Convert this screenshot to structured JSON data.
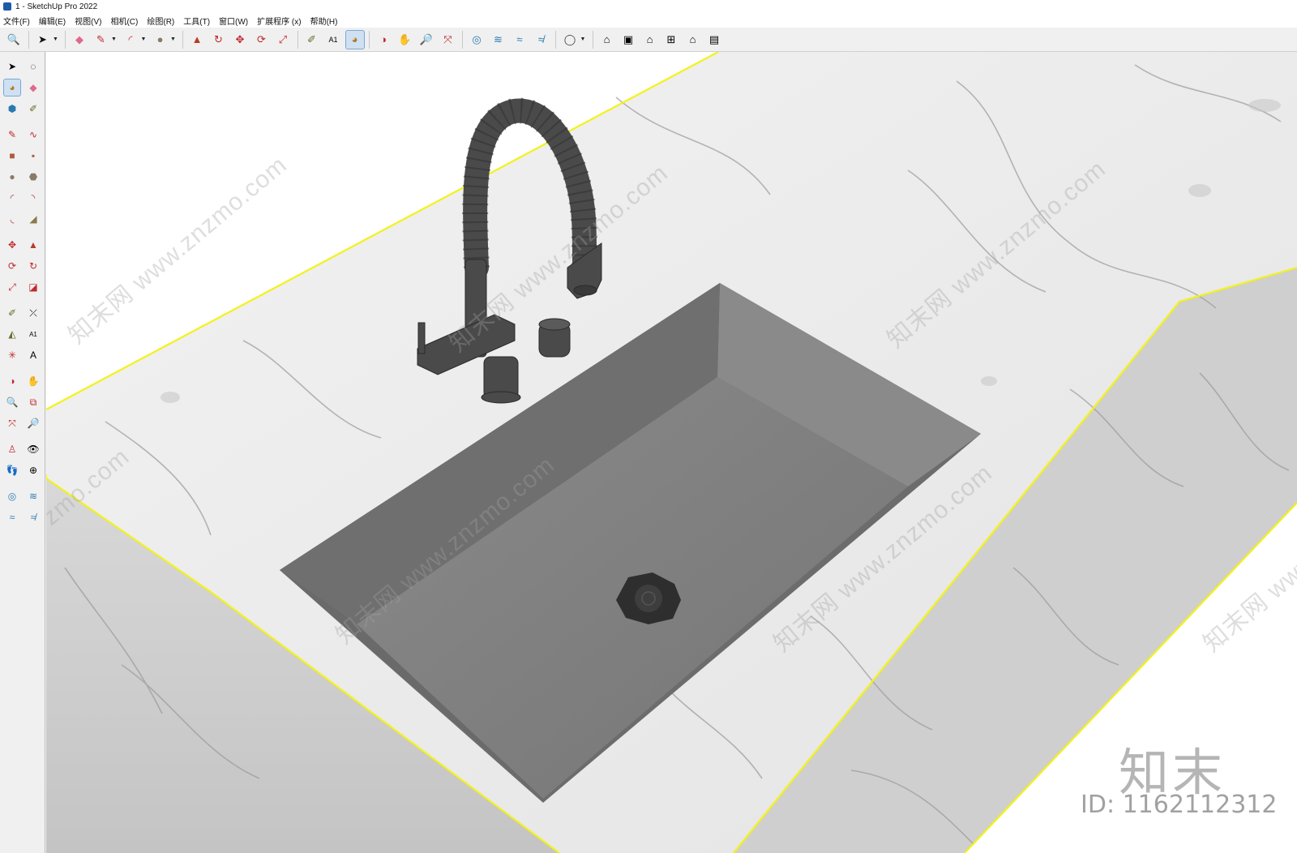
{
  "window": {
    "title": "1 - SketchUp Pro 2022"
  },
  "menu": [
    {
      "key": "file",
      "label": "文件(F)"
    },
    {
      "key": "edit",
      "label": "编辑(E)"
    },
    {
      "key": "view",
      "label": "视图(V)"
    },
    {
      "key": "camera",
      "label": "相机(C)"
    },
    {
      "key": "draw",
      "label": "绘图(R)"
    },
    {
      "key": "tools",
      "label": "工具(T)"
    },
    {
      "key": "window",
      "label": "窗口(W)"
    },
    {
      "key": "extensions",
      "label": "扩展程序 (x)"
    },
    {
      "key": "help",
      "label": "帮助(H)"
    }
  ],
  "toolbar": {
    "tools": [
      "zoom-icon",
      "select-icon",
      "eraser-icon",
      "line-icon",
      "arc-icon",
      "circle-icon",
      "pushpull-icon",
      "followme-icon",
      "move-icon",
      "rotate-icon",
      "scale-icon",
      "tape-icon",
      "text-icon",
      "paint-icon",
      "orbit-icon",
      "pan-icon",
      "zoom-tool-icon",
      "zoom-extents-icon",
      "sandbox-icon",
      "smoove-icon",
      "stamp-icon",
      "drape-icon",
      "user-icon",
      "iso-view-icon",
      "top-view-icon",
      "front-view-icon",
      "right-view-icon",
      "back-view-icon",
      "left-view-icon"
    ],
    "active_tool": "paint-icon"
  },
  "left_tools": {
    "active_tool": "paint-bucket-icon"
  },
  "viewport": {
    "watermark": "知末网 www.znzmo.com",
    "watermark_partial": "zmo.com",
    "brand": "知末",
    "id_label": "ID: 1162112312"
  },
  "colors": {
    "selection_outline": "#f2f21c",
    "marble": "#eeeeee",
    "sink": "#7c7c7c",
    "faucet": "#4a4a4a",
    "active_tool_bg": "#cfe0f3"
  }
}
